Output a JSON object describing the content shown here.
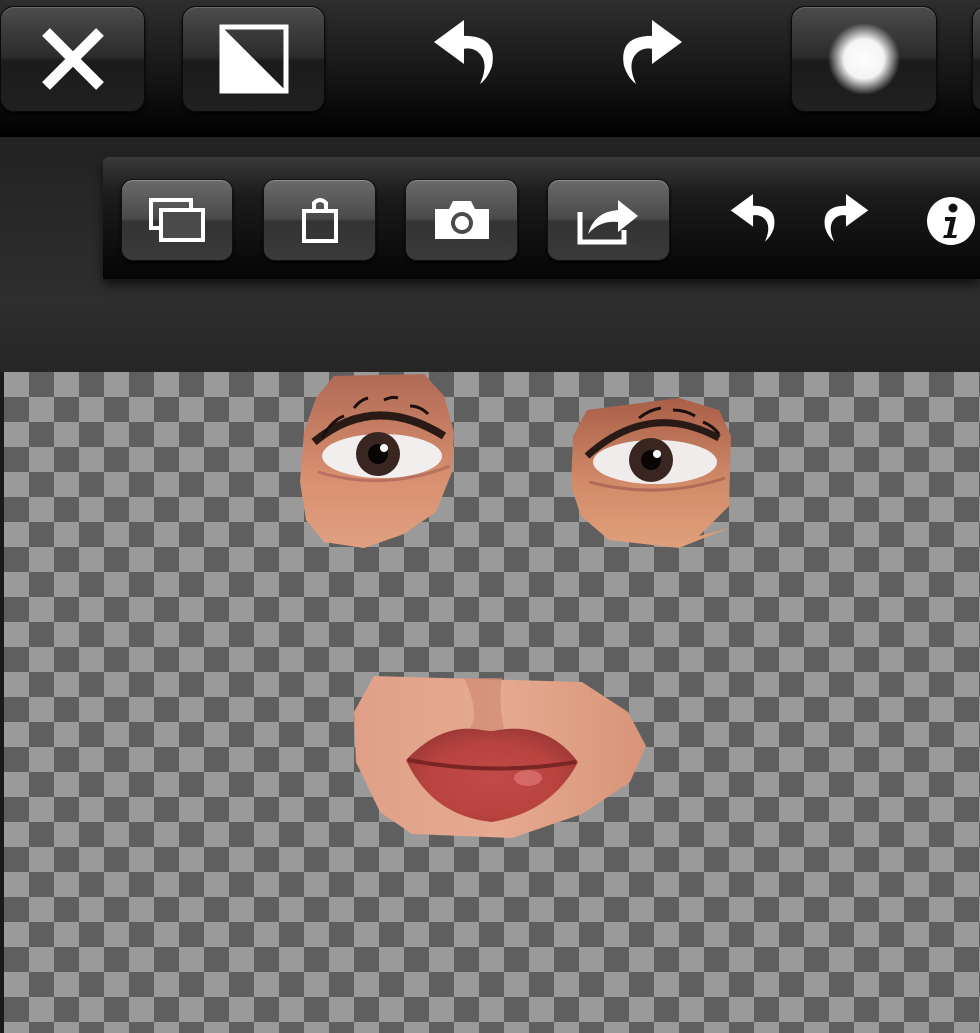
{
  "top_toolbar": {
    "buttons": [
      {
        "name": "close",
        "icon": "close-icon"
      },
      {
        "name": "split",
        "icon": "diagonal-split-icon"
      },
      {
        "name": "undo",
        "icon": "undo-arrow-icon"
      },
      {
        "name": "redo",
        "icon": "redo-arrow-icon"
      },
      {
        "name": "brush",
        "icon": "soft-brush-icon"
      }
    ]
  },
  "secondary_toolbar": {
    "buttons": [
      {
        "name": "layers",
        "icon": "layers-icon"
      },
      {
        "name": "bag",
        "icon": "shopping-bag-icon"
      },
      {
        "name": "camera",
        "icon": "camera-icon"
      },
      {
        "name": "share",
        "icon": "share-icon"
      },
      {
        "name": "undo",
        "icon": "undo-arrow-icon"
      },
      {
        "name": "redo",
        "icon": "redo-arrow-icon"
      },
      {
        "name": "info",
        "icon": "info-icon"
      }
    ]
  },
  "canvas": {
    "pattern": "transparency-checkerboard",
    "pieces": [
      "left-eye",
      "right-eye",
      "lips"
    ]
  },
  "colors": {
    "toolbar": "#141414",
    "checker_dark": "#5f5f5f",
    "checker_light": "#9a9a9a",
    "icon": "#ffffff"
  }
}
